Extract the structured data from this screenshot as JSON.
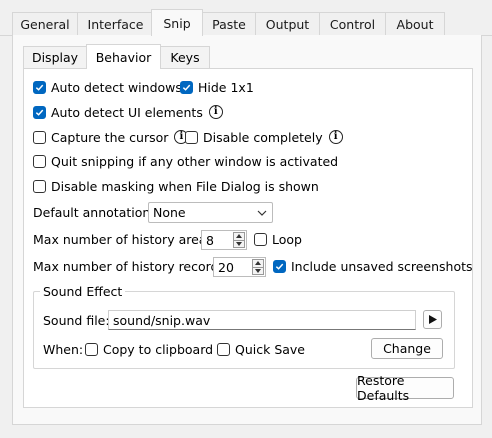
{
  "top_tabs": [
    {
      "label": "General"
    },
    {
      "label": "Interface"
    },
    {
      "label": "Snip"
    },
    {
      "label": "Paste"
    },
    {
      "label": "Output"
    },
    {
      "label": "Control"
    },
    {
      "label": "About"
    }
  ],
  "active_top_tab": "Snip",
  "sub_tabs": [
    {
      "label": "Display"
    },
    {
      "label": "Behavior"
    },
    {
      "label": "Keys"
    }
  ],
  "active_sub_tab": "Behavior",
  "options": {
    "auto_detect_windows": {
      "label": "Auto detect windows",
      "checked": true
    },
    "hide_1x1": {
      "label": "Hide 1x1",
      "checked": true
    },
    "auto_detect_ui": {
      "label": "Auto detect UI elements",
      "checked": true
    },
    "capture_cursor": {
      "label": "Capture the cursor",
      "checked": false
    },
    "disable_completely": {
      "label": "Disable completely",
      "checked": false
    },
    "quit_snipping": {
      "label": "Quit snipping if any other window is activated",
      "checked": false
    },
    "disable_masking": {
      "label": "Disable masking when File Dialog is shown",
      "checked": false
    }
  },
  "default_annotation": {
    "label": "Default annotation:",
    "value": "None"
  },
  "history_areas": {
    "label": "Max number of history areas:",
    "value": "8",
    "loop_label": "Loop",
    "loop_checked": false
  },
  "history_records": {
    "label": "Max number of history records:",
    "value": "20",
    "include_label": "Include unsaved screenshots",
    "include_checked": true
  },
  "sound_effect": {
    "title": "Sound Effect",
    "file_label": "Sound file:",
    "file_value": "sound/snip.wav",
    "when_label": "When:",
    "copy_label": "Copy to clipboard",
    "copy_checked": false,
    "save_label": "Quick Save",
    "save_checked": false,
    "change_button": "Change"
  },
  "restore_button": "Restore Defaults",
  "accent_color": "#0067c0"
}
